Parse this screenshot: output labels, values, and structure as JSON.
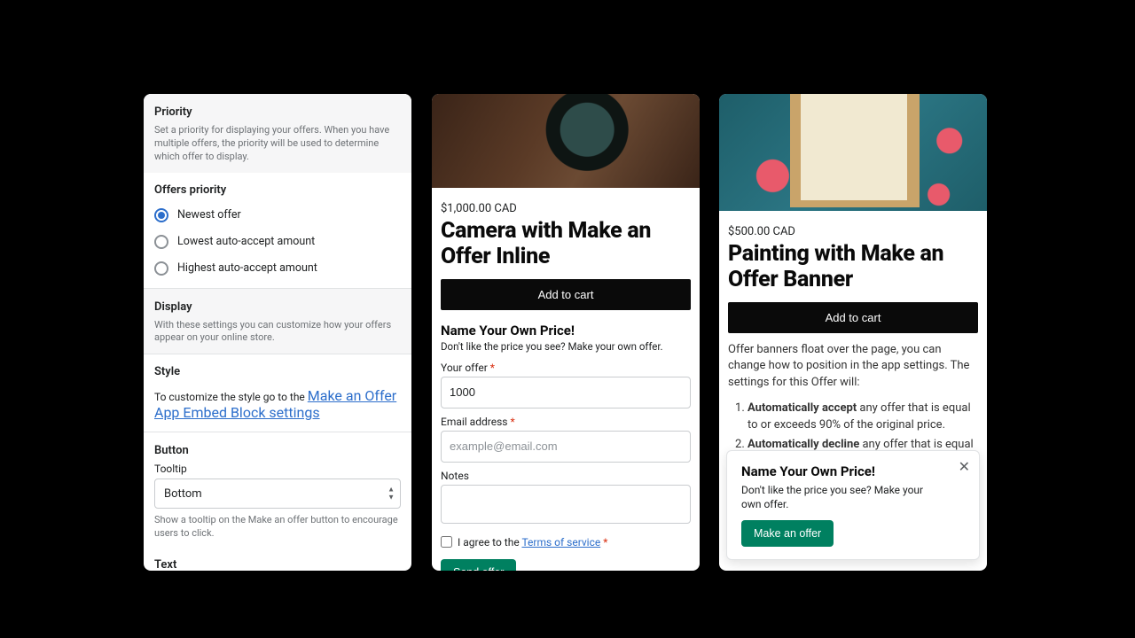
{
  "settings": {
    "priority": {
      "title": "Priority",
      "desc": "Set a priority for displaying your offers. When you have multiple offers, the priority will be used to determine which offer to display.",
      "subtitle": "Offers priority",
      "options": {
        "0": "Newest offer",
        "1": "Lowest auto-accept amount",
        "2": "Highest auto-accept amount"
      },
      "selected": 0
    },
    "display": {
      "title": "Display",
      "desc": "With these settings you can customize how your offers appear on your online store."
    },
    "style": {
      "title": "Style",
      "lead": "To customize the style go to the ",
      "link": "Make an Offer App Embed Block settings"
    },
    "button": {
      "title": "Button",
      "tooltip_label": "Tooltip",
      "tooltip_value": "Bottom",
      "help": "Show a tooltip on the Make an offer button to encourage users to click."
    },
    "text": {
      "title": "Text"
    }
  },
  "inline": {
    "price": "$1,000.00 CAD",
    "title": "Camera with Make an Offer Inline",
    "add_to_cart": "Add to cart",
    "offer_heading": "Name Your Own Price!",
    "offer_sub": "Don't like the price you see? Make your own offer.",
    "your_offer_label": "Your offer",
    "your_offer_value": "1000",
    "email_label": "Email address",
    "email_placeholder": "example@email.com",
    "notes_label": "Notes",
    "agree_lead": "I agree to the ",
    "tos": "Terms of service",
    "send": "Send offer"
  },
  "banner": {
    "price": "$500.00 CAD",
    "title": "Painting with Make an Offer Banner",
    "add_to_cart": "Add to cart",
    "body": "Offer banners float over the page, you can change how to position in the app settings. The settings for this Offer will:",
    "rule1_bold": "Automatically accept",
    "rule1_rest": " any offer that is equal to or exceeds 90% of the original price.",
    "rule2_bold": "Automatically decline",
    "rule2_rest": " any offer that is equal to",
    "popup": {
      "heading": "Name Your Own Price!",
      "sub": "Don't like the price you see? Make your own offer.",
      "cta": "Make an offer"
    }
  }
}
